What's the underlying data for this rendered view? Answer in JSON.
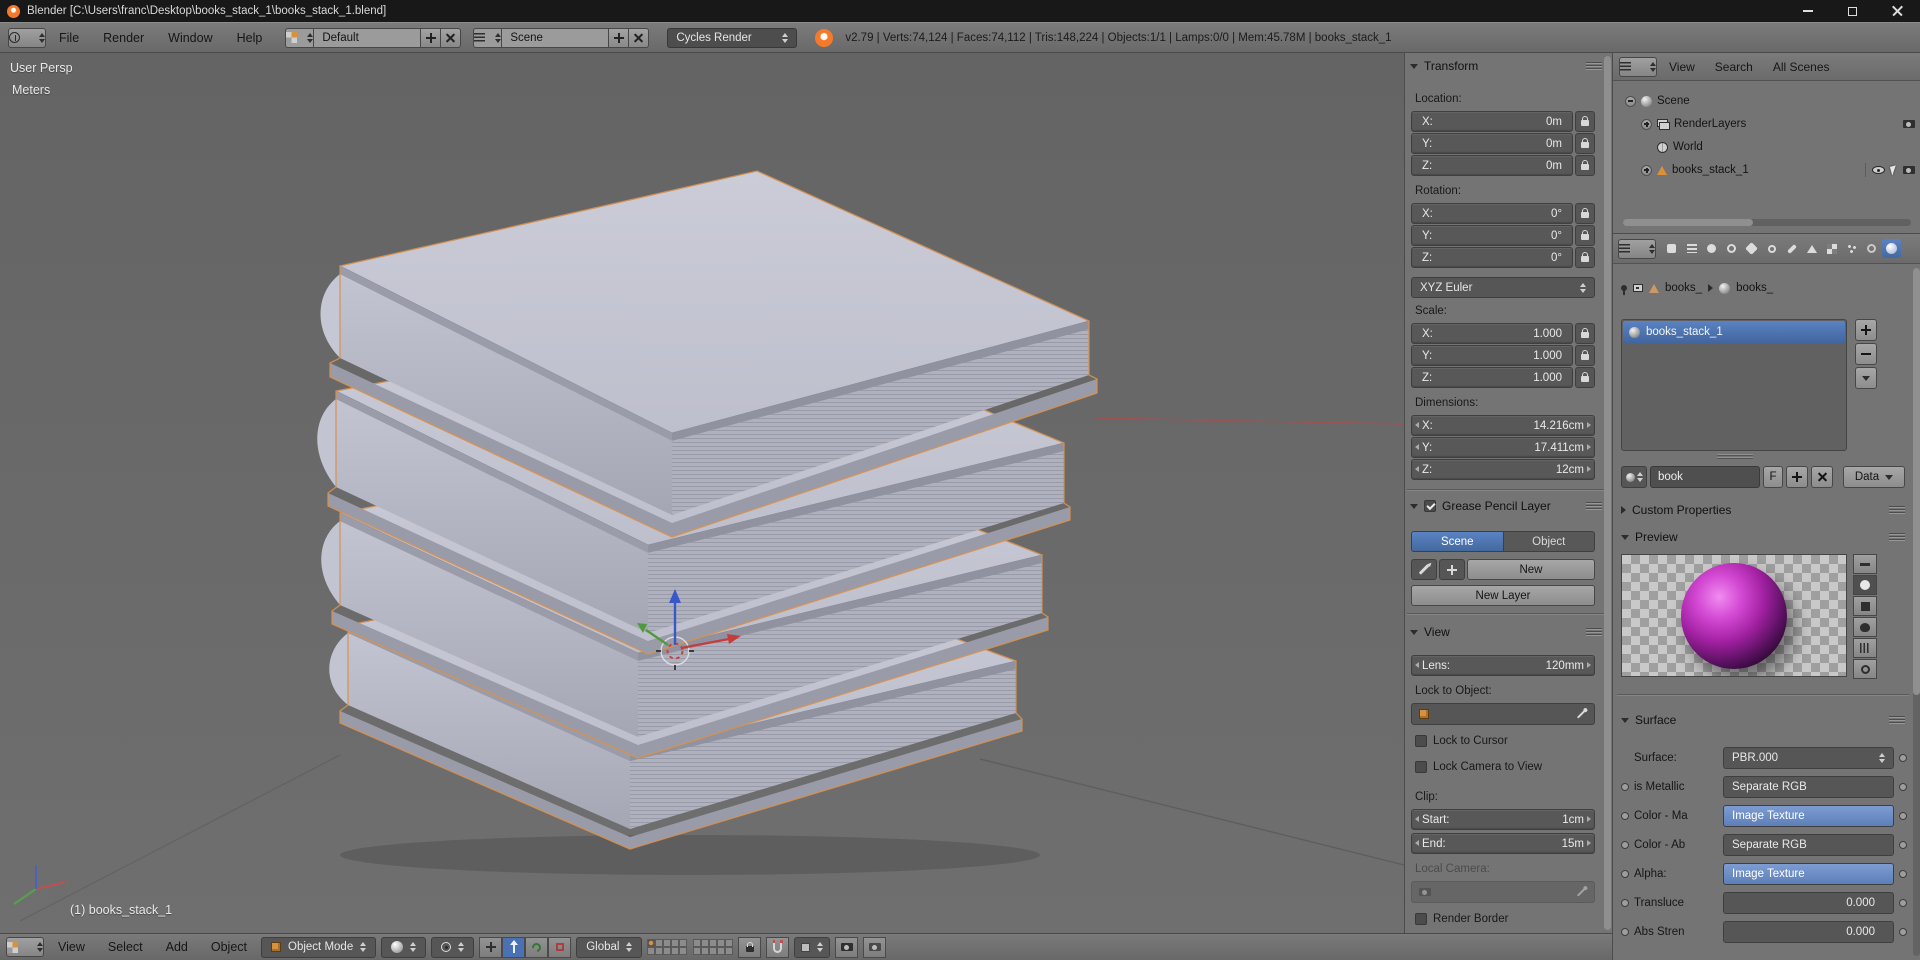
{
  "colors": {
    "accent_blue": "#4a71b4",
    "field_highlight_blue": "#6b8dc4",
    "selection_outline_orange": "#d8914e",
    "preview_material_magenta": "#c23cc2",
    "axis_x_red": "#c43d3d",
    "axis_y_green": "#4f9a3f",
    "axis_z_blue": "#3857c9"
  },
  "window": {
    "title": "Blender [C:\\Users\\franc\\Desktop\\books_stack_1\\books_stack_1.blend]"
  },
  "info_header": {
    "menus": [
      {
        "label": "File"
      },
      {
        "label": "Render"
      },
      {
        "label": "Window"
      },
      {
        "label": "Help"
      }
    ],
    "layout_value": "Default",
    "scene_value": "Scene",
    "engine_value": "Cycles Render",
    "stats": "v2.79 | Verts:74,124 | Faces:74,112 | Tris:148,224 | Objects:1/1 | Lamps:0/0 | Mem:45.78M | books_stack_1"
  },
  "viewport": {
    "view_label": "User Persp",
    "units_label": "Meters",
    "active_object": "(1) books_stack_1"
  },
  "viewport_header": {
    "menus": [
      {
        "label": "View"
      },
      {
        "label": "Select"
      },
      {
        "label": "Add"
      },
      {
        "label": "Object"
      }
    ],
    "mode_value": "Object Mode",
    "orientation_value": "Global",
    "icon_buttons": [
      "manipulator-axis",
      "translate-manipulator",
      "rotate-manipulator",
      "scale-manipulator",
      "layers",
      "lock-layers",
      "snap-magnet",
      "snap-element",
      "opengl-render",
      "opengl-render-animation"
    ]
  },
  "n_panel": {
    "transform": {
      "title": "Transform",
      "location_label": "Location:",
      "location_rows": [
        {
          "axis": "X:",
          "value": "0m"
        },
        {
          "axis": "Y:",
          "value": "0m"
        },
        {
          "axis": "Z:",
          "value": "0m"
        }
      ],
      "rotation_label": "Rotation:",
      "rotation_rows": [
        {
          "axis": "X:",
          "value": "0°"
        },
        {
          "axis": "Y:",
          "value": "0°"
        },
        {
          "axis": "Z:",
          "value": "0°"
        }
      ],
      "rotation_mode": "XYZ Euler",
      "scale_label": "Scale:",
      "scale_rows": [
        {
          "axis": "X:",
          "value": "1.000"
        },
        {
          "axis": "Y:",
          "value": "1.000"
        },
        {
          "axis": "Z:",
          "value": "1.000"
        }
      ],
      "dimensions_label": "Dimensions:",
      "dimension_rows": [
        {
          "axis": "X:",
          "value": "14.216cm"
        },
        {
          "axis": "Y:",
          "value": "17.411cm"
        },
        {
          "axis": "Z:",
          "value": "12cm"
        }
      ]
    },
    "grease_pencil": {
      "title": "Grease Pencil Layer",
      "tab_scene": "Scene",
      "tab_object": "Object",
      "new_button": "New",
      "new_layer_button": "New Layer"
    },
    "view": {
      "title": "View",
      "lens_label": "Lens:",
      "lens_value": "120mm",
      "lock_object_label": "Lock to Object:",
      "lock_cursor_label": "Lock to Cursor",
      "lock_camera_label": "Lock Camera to View",
      "clip_label": "Clip:",
      "start_label": "Start:",
      "start_value": "1cm",
      "end_label": "End:",
      "end_value": "15m",
      "local_camera_label": "Local Camera:",
      "render_border_label": "Render Border"
    }
  },
  "outliner": {
    "menu_view": "View",
    "menu_search": "Search",
    "filter_value": "All Scenes",
    "items": [
      {
        "label": "Scene"
      },
      {
        "label": "RenderLayers"
      },
      {
        "label": "World"
      },
      {
        "label": "books_stack_1"
      }
    ]
  },
  "properties": {
    "tab_icons": [
      "render",
      "render-layers",
      "scene",
      "world",
      "object",
      "constraints",
      "modifiers",
      "object-data",
      "texture",
      "particles",
      "physics",
      "material"
    ],
    "breadcrumb": {
      "object": "books_",
      "material": "books_"
    },
    "slots": {
      "selected": "books_stack_1"
    },
    "datablock": {
      "name": "book",
      "fake_user": "F"
    },
    "data_toggle": "Data",
    "custom_properties_title": "Custom Properties",
    "preview_title": "Preview",
    "preview_types": [
      "flat",
      "sphere",
      "cube",
      "monkey",
      "hair",
      "world"
    ],
    "surface_title": "Surface",
    "surface_rows": [
      {
        "label": "Surface:",
        "value": "PBR.000"
      },
      {
        "label": "is Metallic",
        "value": "Separate RGB"
      },
      {
        "label": "Color - Ma",
        "value": "Image Texture"
      },
      {
        "label": "Color - Ab",
        "value": "Separate RGB"
      },
      {
        "label": "Alpha:",
        "value": "Image Texture"
      },
      {
        "label": "Transluce",
        "value": "0.000"
      },
      {
        "label": "Abs Stren",
        "value": "0.000"
      }
    ]
  }
}
